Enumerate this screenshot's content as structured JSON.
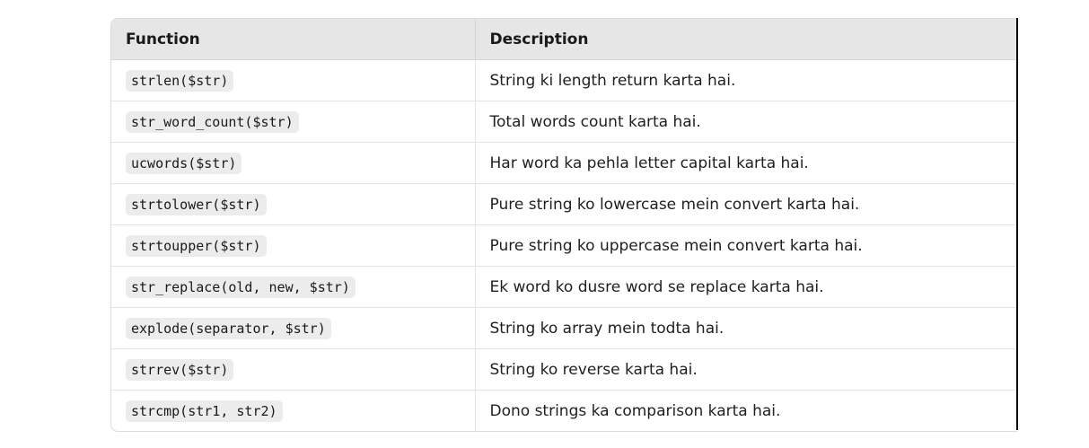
{
  "table": {
    "headers": [
      "Function",
      "Description"
    ],
    "rows": [
      {
        "function": "strlen($str)",
        "description": "String ki length return karta hai."
      },
      {
        "function": "str_word_count($str)",
        "description": "Total words count karta hai."
      },
      {
        "function": "ucwords($str)",
        "description": "Har word ka pehla letter capital karta hai."
      },
      {
        "function": "strtolower($str)",
        "description": "Pure string ko lowercase mein convert karta hai."
      },
      {
        "function": "strtoupper($str)",
        "description": "Pure string ko uppercase mein convert karta hai."
      },
      {
        "function": "str_replace(old, new, $str)",
        "description": "Ek word ko dusre word se replace karta hai."
      },
      {
        "function": "explode(separator, $str)",
        "description": "String ko array mein todta hai."
      },
      {
        "function": "strrev($str)",
        "description": "String ko reverse karta hai."
      },
      {
        "function": "strcmp(str1, str2)",
        "description": "Dono strings ka comparison karta hai."
      }
    ]
  }
}
